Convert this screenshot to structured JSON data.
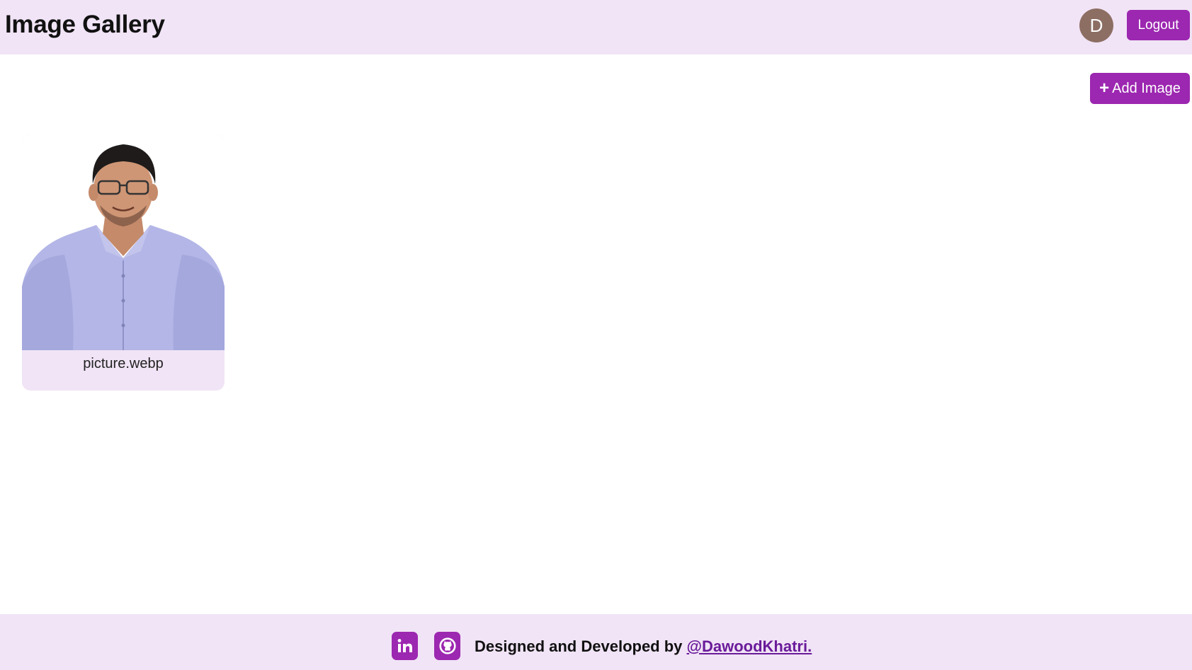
{
  "header": {
    "title": "Image Gallery",
    "avatar_initial": "D",
    "logout_label": "Logout"
  },
  "toolbar": {
    "add_image_label": "Add Image",
    "add_icon": "plus-icon"
  },
  "gallery": {
    "items": [
      {
        "caption": "picture.webp"
      }
    ]
  },
  "footer": {
    "credit_text": "Designed and Developed by",
    "author_link": "@DawoodKhatri.",
    "icons": [
      "linkedin-icon",
      "github-icon"
    ]
  },
  "colors": {
    "accent": "#9c27b0",
    "header_bg": "#f1e4f6",
    "avatar_bg": "#8d6e63",
    "link": "#6a1b9a"
  }
}
